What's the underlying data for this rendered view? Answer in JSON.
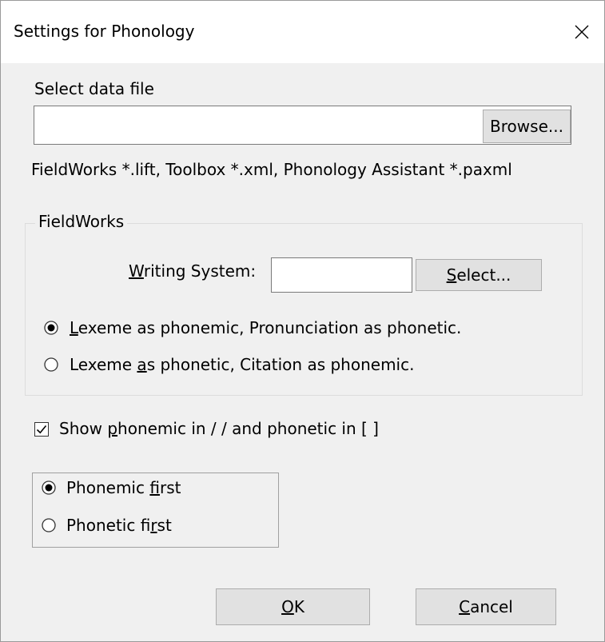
{
  "dialog": {
    "title": "Settings for Phonology"
  },
  "data_file": {
    "label": "Select data file",
    "path_value": "",
    "browse_label": "Browse...",
    "hint": "FieldWorks *.lift, Toolbox *.xml, Phonology Assistant *.paxml"
  },
  "fieldworks": {
    "legend": "FieldWorks",
    "writing_system": {
      "label_mnemonic": "W",
      "label_rest": "riting System:",
      "value": "",
      "select_mnemonic": "S",
      "select_rest": "elect..."
    },
    "options": [
      {
        "pre": "",
        "mnemonic": "L",
        "post": "exeme as phonemic, Pronunciation as phonetic.",
        "selected": true
      },
      {
        "pre": "Lexeme ",
        "mnemonic": "a",
        "post": "s phonetic, Citation as phonemic.",
        "selected": false
      }
    ]
  },
  "show_brackets": {
    "checked": true,
    "pre": "Show ",
    "mnemonic": "p",
    "post": "honemic in / / and phonetic in [ ]"
  },
  "order": {
    "options": [
      {
        "pre": "Phonemic ",
        "mnemonic": "f",
        "post": "irst",
        "selected": true
      },
      {
        "pre": "Phonetic fi",
        "mnemonic": "r",
        "post": "st",
        "selected": false
      }
    ]
  },
  "buttons": {
    "ok_mnemonic": "O",
    "ok_rest": "K",
    "cancel_mnemonic": "C",
    "cancel_rest": "ancel"
  },
  "icons": {
    "close": "close-icon",
    "radio": "radio-icon",
    "check": "checkmark-icon"
  }
}
